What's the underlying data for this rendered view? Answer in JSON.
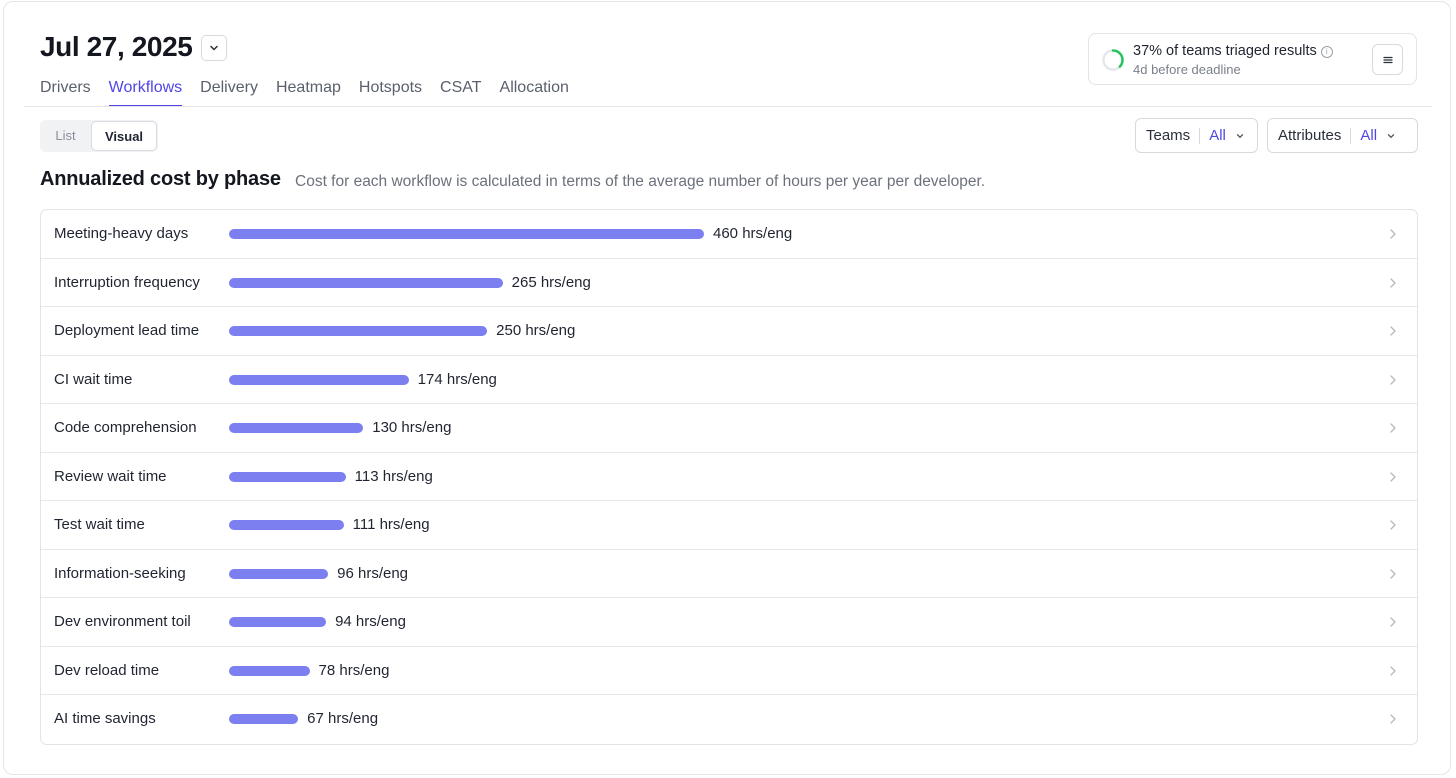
{
  "header": {
    "date": "Jul 27, 2025",
    "date_dropdown_icon": "chevron-down-icon"
  },
  "tabs": [
    {
      "label": "Drivers",
      "active": false
    },
    {
      "label": "Workflows",
      "active": true
    },
    {
      "label": "Delivery",
      "active": false
    },
    {
      "label": "Heatmap",
      "active": false
    },
    {
      "label": "Hotspots",
      "active": false
    },
    {
      "label": "CSAT",
      "active": false
    },
    {
      "label": "Allocation",
      "active": false
    }
  ],
  "triage": {
    "text": "37% of teams triaged results",
    "progress": 37,
    "subtext": "4d before deadline",
    "ring_color": "#22c55e",
    "menu_icon": "menu-icon"
  },
  "view_toggle": {
    "list_label": "List",
    "visual_label": "Visual",
    "selected": "Visual"
  },
  "filters": {
    "teams_label": "Teams",
    "teams_value": "All",
    "attributes_label": "Attributes",
    "attributes_value": "All"
  },
  "section": {
    "title": "Annualized cost by phase",
    "description": "Cost for each workflow is calculated in terms of the average number of hours per year per developer."
  },
  "colors": {
    "accent": "#4f46e5",
    "bar": "#7b7ff0"
  },
  "chart_data": {
    "type": "bar",
    "unit": "hrs/eng",
    "categories": [
      "Meeting-heavy days",
      "Interruption frequency",
      "Deployment lead time",
      "CI wait time",
      "Code comprehension",
      "Review wait time",
      "Test wait time",
      "Information-seeking",
      "Dev environment toil",
      "Dev reload time",
      "AI time savings"
    ],
    "values": [
      460,
      265,
      250,
      174,
      130,
      113,
      111,
      96,
      94,
      78,
      67
    ],
    "value_labels": [
      "460 hrs/eng",
      "265 hrs/eng",
      "250 hrs/eng",
      "174 hrs/eng",
      "130 hrs/eng",
      "113 hrs/eng",
      "111 hrs/eng",
      "96 hrs/eng",
      "94 hrs/eng",
      "78 hrs/eng",
      "67 hrs/eng"
    ]
  }
}
